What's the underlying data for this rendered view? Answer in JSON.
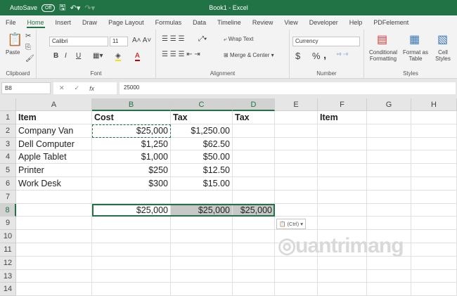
{
  "titlebar": {
    "autosave_label": "AutoSave",
    "autosave_state": "Off",
    "title": "Book1  -  Excel",
    "color": "#217346"
  },
  "tabs": [
    "File",
    "Home",
    "Insert",
    "Draw",
    "Page Layout",
    "Formulas",
    "Data",
    "Timeline",
    "Review",
    "View",
    "Developer",
    "Help",
    "PDFelement"
  ],
  "active_tab": "Home",
  "ribbon": {
    "clipboard": {
      "label": "Clipboard",
      "paste": "Paste"
    },
    "font": {
      "label": "Font",
      "name": "Calibri",
      "size": "11",
      "bold": "B",
      "italic": "I",
      "underline": "U"
    },
    "alignment": {
      "label": "Alignment",
      "wrap_text": "Wrap Text",
      "merge_center": "Merge & Center"
    },
    "number": {
      "label": "Number",
      "format": "Currency",
      "dollar": "$",
      "percent": "%",
      "comma": ","
    },
    "styles": {
      "label": "Styles",
      "conditional": "Conditional Formatting",
      "format_table": "Format as Table",
      "cell_styles": "Cell Styles"
    }
  },
  "formula_bar": {
    "name_box": "B8",
    "formula": "25000",
    "fx": "fx"
  },
  "columns": [
    "A",
    "B",
    "C",
    "D",
    "E",
    "F",
    "G",
    "H"
  ],
  "rows": [
    "1",
    "2",
    "3",
    "4",
    "5",
    "6",
    "7",
    "8",
    "9",
    "10",
    "11",
    "12",
    "13",
    "14"
  ],
  "cells": {
    "A1": "Item",
    "B1": "Cost",
    "C1": "Tax",
    "D1": "Tax",
    "F1": "Item",
    "A2": "Company Van",
    "B2": "$25,000",
    "C2": "$1,250.00",
    "A3": "Dell Computer",
    "B3": "$1,250",
    "C3": "$62.50",
    "A4": "Apple Tablet",
    "B4": "$1,000",
    "C4": "$50.00",
    "A5": "Printer",
    "B5": "$250",
    "C5": "$12.50",
    "A6": "Work Desk",
    "B6": "$300",
    "C6": "$15.00",
    "B8": "$25,000",
    "C8": "$25,000",
    "D8": "$25,000"
  },
  "paste_options": "(Ctrl)"
}
